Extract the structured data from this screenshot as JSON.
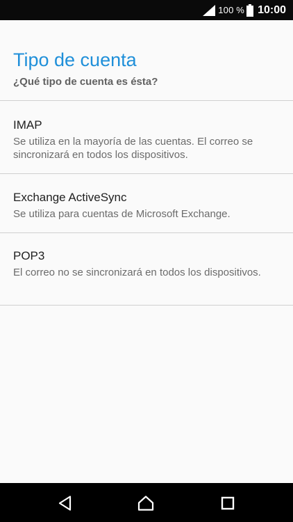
{
  "status_bar": {
    "battery_percent": "100 %",
    "time": "10:00",
    "icons": [
      "signal-icon",
      "battery-icon"
    ]
  },
  "header": {
    "title": "Tipo de cuenta",
    "subtitle": "¿Qué tipo de cuenta es ésta?"
  },
  "options": [
    {
      "title": "IMAP",
      "description": "Se utiliza en la mayoría de las cuentas. El correo se sincronizará en todos los dispositivos."
    },
    {
      "title": "Exchange ActiveSync",
      "description": "Se utiliza para cuentas de Microsoft Exchange."
    },
    {
      "title": "POP3",
      "description": "El correo no se sincronizará en todos los dispositivos."
    }
  ],
  "nav_bar": {
    "icons": [
      "back-icon",
      "home-icon",
      "recents-icon"
    ]
  },
  "colors": {
    "accent": "#1f8fd9",
    "status_bar_bg": "#0a0a0a",
    "nav_bar_bg": "#000000",
    "background": "#fafafa",
    "divider": "#cfcfcf"
  }
}
